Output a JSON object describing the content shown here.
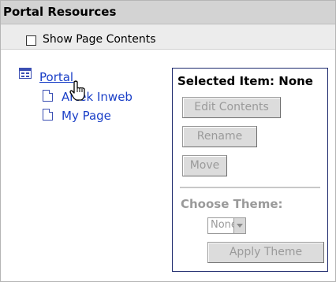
{
  "header": {
    "title": "Portal Resources"
  },
  "options": {
    "show_page_contents_label": "Show Page Contents",
    "show_page_contents_checked": false
  },
  "tree": {
    "root": {
      "label": "Portal",
      "icon": "portal-icon"
    },
    "children": [
      {
        "label": "Artek Inweb",
        "icon": "page-icon"
      },
      {
        "label": "My Page",
        "icon": "page-icon"
      }
    ]
  },
  "panel": {
    "title": "Selected Item: None",
    "buttons": {
      "edit_contents": "Edit Contents",
      "rename": "Rename",
      "move": "Move"
    },
    "theme": {
      "label": "Choose Theme:",
      "selected": "None",
      "apply": "Apply Theme"
    }
  },
  "colors": {
    "header_bg": "#d3d3d3",
    "link": "#1a3fc7",
    "panel_border": "#1e2a6e",
    "disabled_text": "#9a9a9a"
  }
}
